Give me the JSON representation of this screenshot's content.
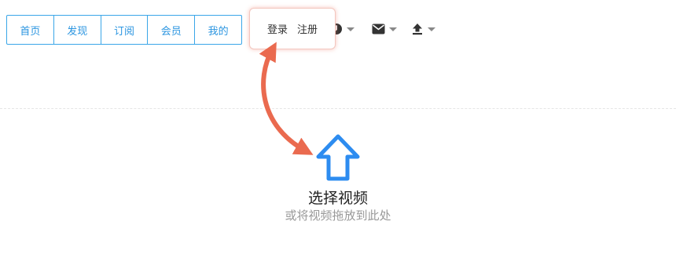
{
  "nav": {
    "tabs": [
      "首页",
      "发现",
      "订阅",
      "会员",
      "我的"
    ]
  },
  "auth": {
    "login_label": "登录",
    "register_label": "注册"
  },
  "toolbar": {
    "icons": [
      "history-icon",
      "mail-icon",
      "upload-icon"
    ]
  },
  "upload": {
    "title": "选择视频",
    "hint": "或将视频拖放到此处"
  },
  "colors": {
    "accent": "#2b95e0",
    "annotation": "#ea6a4f",
    "upload_icon": "#2d8cf0"
  }
}
